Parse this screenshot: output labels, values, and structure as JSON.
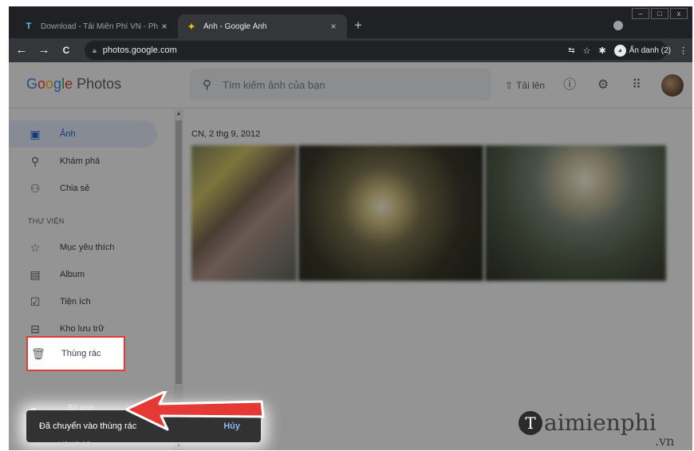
{
  "browser": {
    "tabs": [
      {
        "icon": "T",
        "title": "Download - Tải Miễn Phí VN - Ph",
        "close": "×"
      },
      {
        "icon": "✦",
        "title": "Ảnh - Google Ảnh",
        "close": "×"
      }
    ],
    "new_tab": "+",
    "window_controls": [
      "–",
      "□",
      "x"
    ],
    "back": "←",
    "forward": "→",
    "reload": "C",
    "url": "photos.google.com",
    "incognito_label": "Ẩn danh (2)"
  },
  "app": {
    "logo": {
      "g": "G",
      "o1": "o",
      "o2": "o",
      "g2": "g",
      "l": "l",
      "e": "e",
      "rest": " Photos"
    },
    "search_placeholder": "Tìm kiếm ảnh của bạn",
    "upload_label": "Tải lên"
  },
  "sidebar": {
    "items": [
      {
        "label": "Ảnh",
        "icon": "photo-icon"
      },
      {
        "label": "Khám phá",
        "icon": "search-icon"
      },
      {
        "label": "Chia sẻ",
        "icon": "people-icon"
      }
    ],
    "section_label": "THƯ VIỆN",
    "library": [
      {
        "label": "Mục yêu thích",
        "icon": "star-icon"
      },
      {
        "label": "Album",
        "icon": "album-icon"
      },
      {
        "label": "Tiện ích",
        "icon": "utilities-icon"
      },
      {
        "label": "Kho lưu trữ",
        "icon": "archive-icon"
      },
      {
        "label": "Thùng rác",
        "icon": "trash-icon"
      }
    ],
    "storage_label": "Bộ nhớ",
    "storage_value": "MB/15 GB"
  },
  "main": {
    "date_heading": "CN, 2 thg 9, 2012"
  },
  "snackbar": {
    "message": "Đã chuyển vào thùng rác",
    "action": "Hủy"
  },
  "watermark": {
    "main": "aimienphi",
    "badge": "T",
    "suffix": ".vn"
  },
  "colors": {
    "highlight": "#e53935",
    "accent": "#1967d2"
  }
}
